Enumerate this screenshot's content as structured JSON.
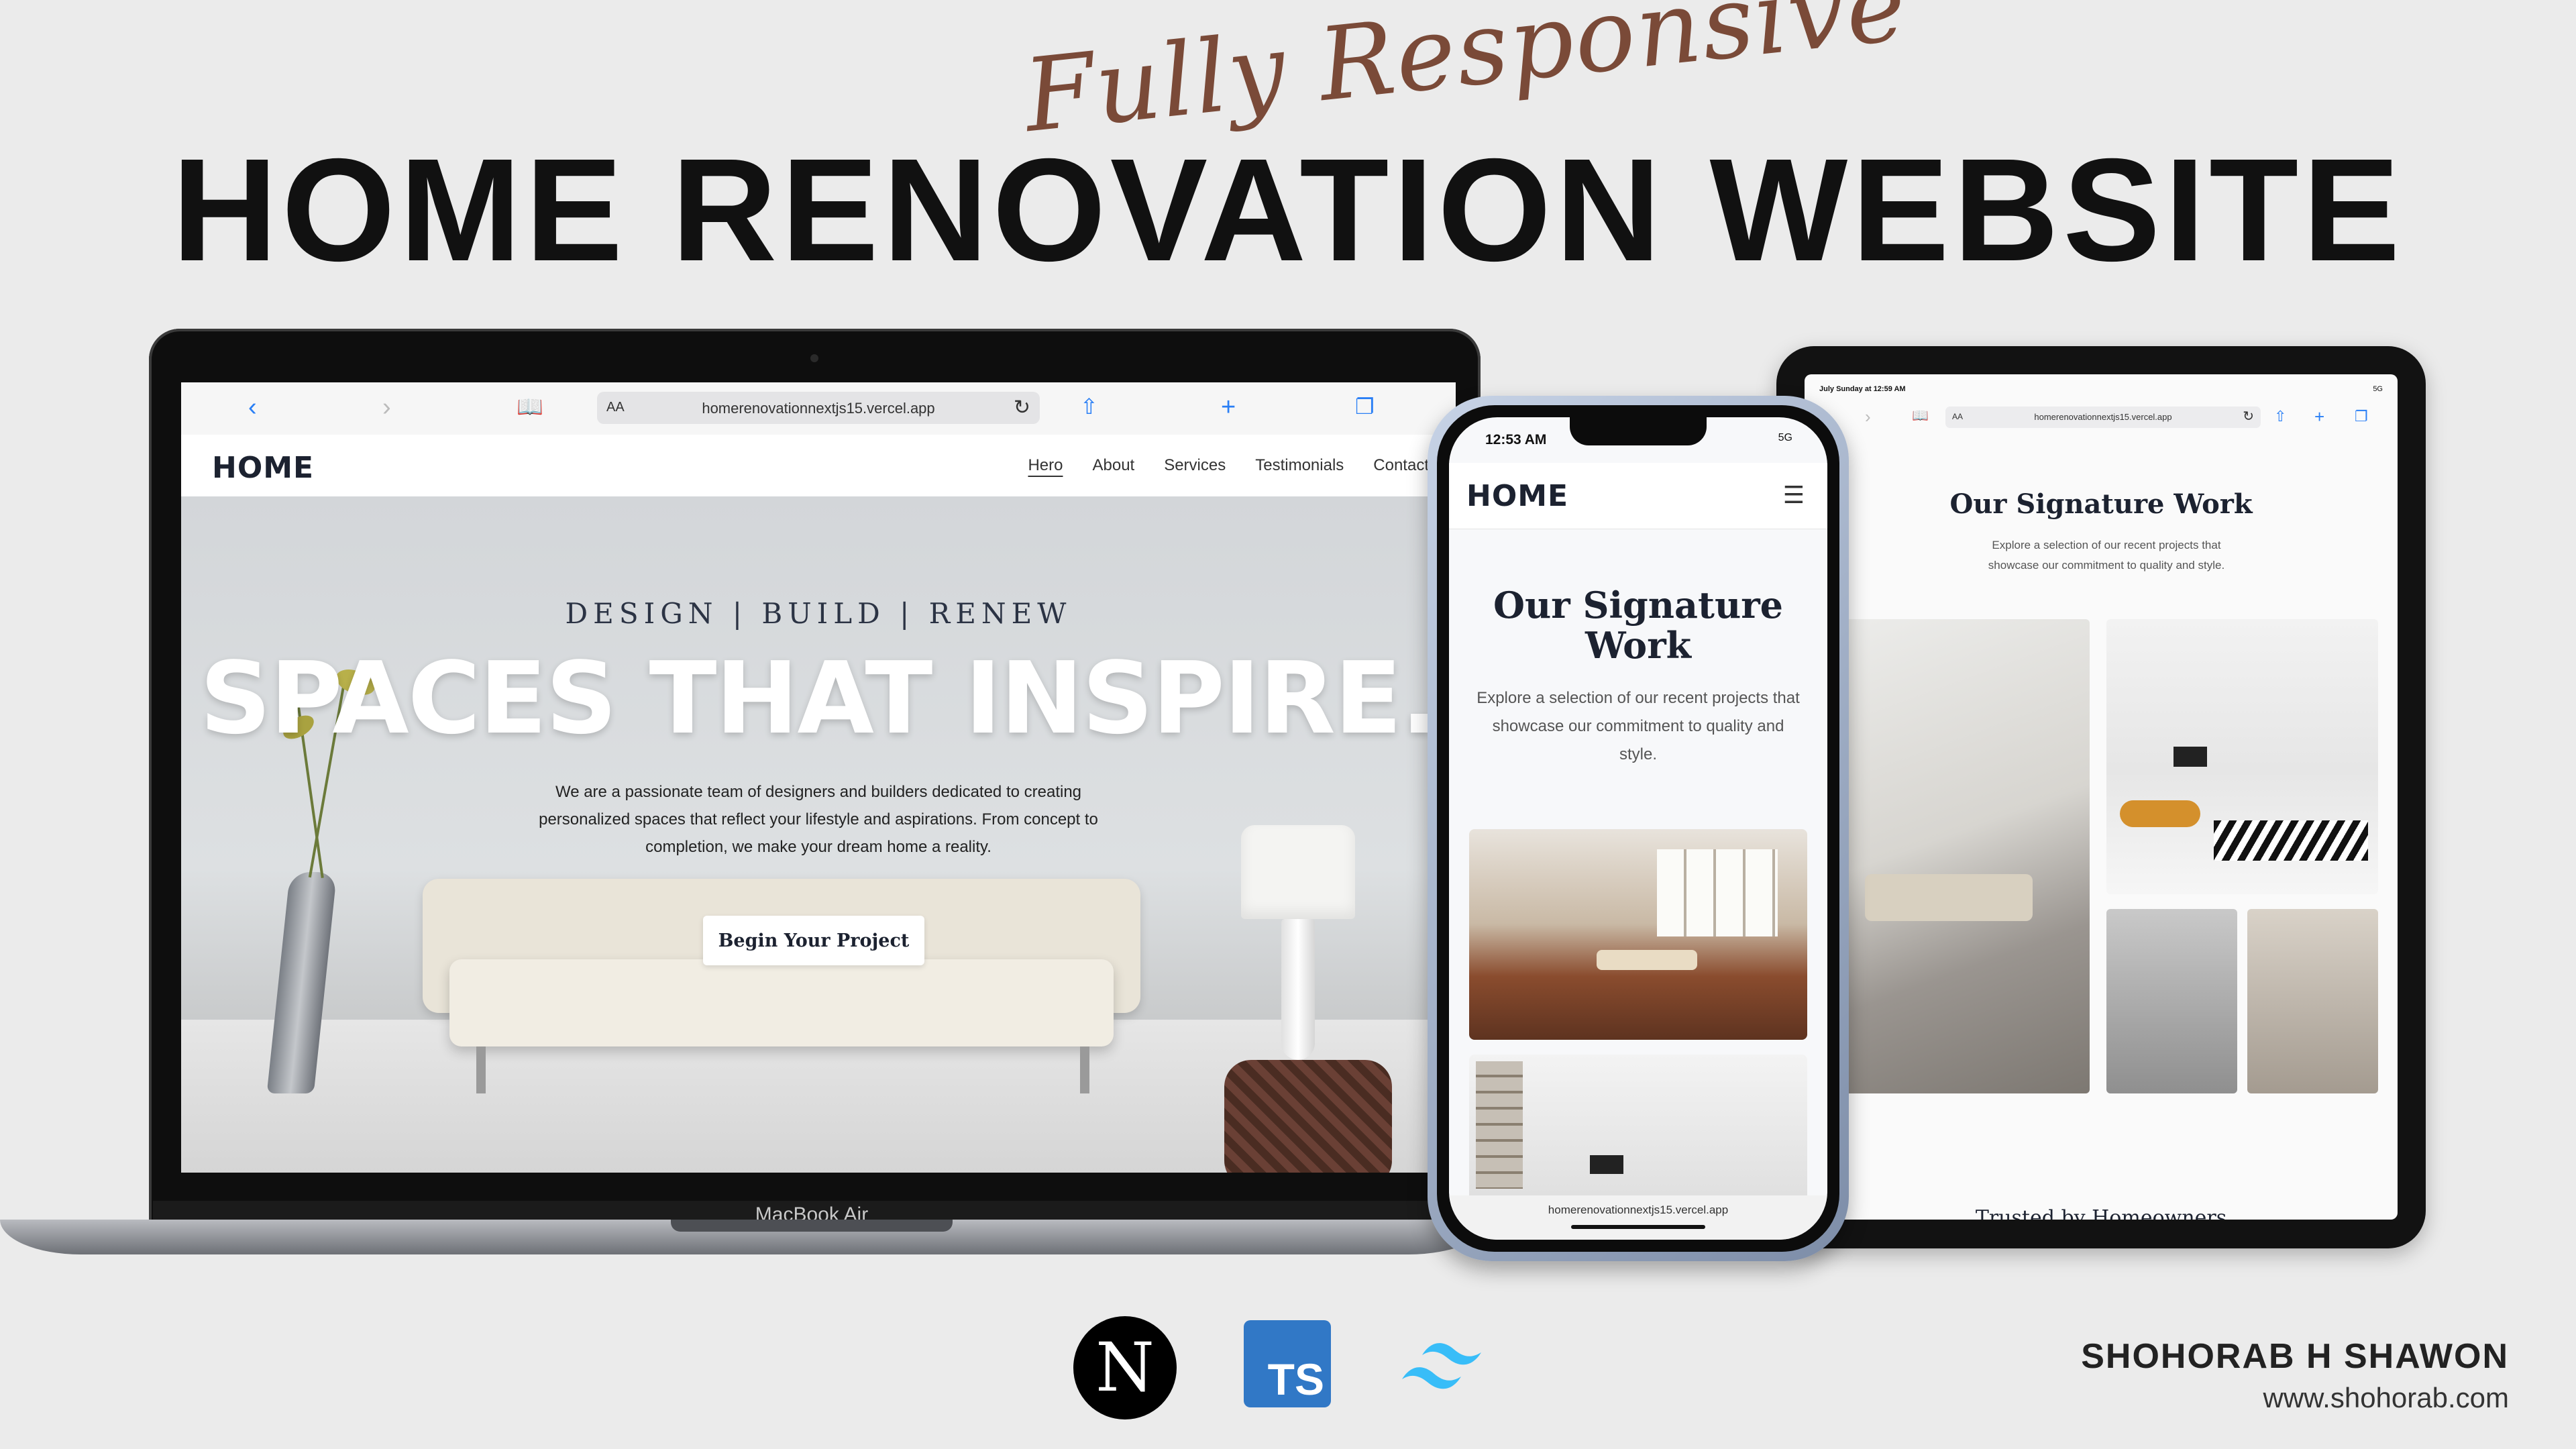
{
  "headline": {
    "script": "Fully Responsive",
    "title": "HOME RENOVATION WEBSITE"
  },
  "laptop": {
    "model_label": "MacBook Air",
    "browser": {
      "url_prefix": "AA",
      "url": "homerenovationnextjs15.vercel.app"
    },
    "site": {
      "logo": "HOME",
      "nav": [
        "Hero",
        "About",
        "Services",
        "Testimonials",
        "Contact"
      ],
      "active_nav": "Hero",
      "hero": {
        "eyebrow": "DESIGN | BUILD | RENEW",
        "title": "SPACES THAT INSPIRE.",
        "text": "We are a passionate team of designers and builders dedicated to creating personalized spaces that reflect your lifestyle and aspirations. From concept to completion, we make your dream home a reality.",
        "button": "Begin Your Project"
      }
    }
  },
  "tablet": {
    "status_left": "July Sunday at 12:59 AM",
    "status_right": "5G",
    "browser": {
      "url_prefix": "AA",
      "url": "homerenovationnextjs15.vercel.app"
    },
    "section": {
      "heading": "Our Signature Work",
      "subtitle": "Explore a selection of our recent projects that showcase our commitment to quality and style.",
      "next_heading": "Trusted by Homeowners"
    }
  },
  "phone": {
    "time": "12:53 AM",
    "signal": "5G",
    "logo": "HOME",
    "section": {
      "heading": "Our Signature Work",
      "subtitle": "Explore a selection of our recent projects that showcase our commitment to quality and style."
    },
    "url": "homerenovationnextjs15.vercel.app"
  },
  "tech_stack": {
    "next_letter": "N",
    "ts_label": "TS"
  },
  "author": {
    "name": "SHOHORAB H SHAWON",
    "website": "www.shohorab.com"
  },
  "colors": {
    "background": "#ebebeb",
    "script_brown": "#7a4a38",
    "navy": "#1c2230",
    "safari_blue": "#2a7ff5",
    "ts_blue": "#3178c6",
    "tailwind_cyan": "#38bdf8"
  }
}
